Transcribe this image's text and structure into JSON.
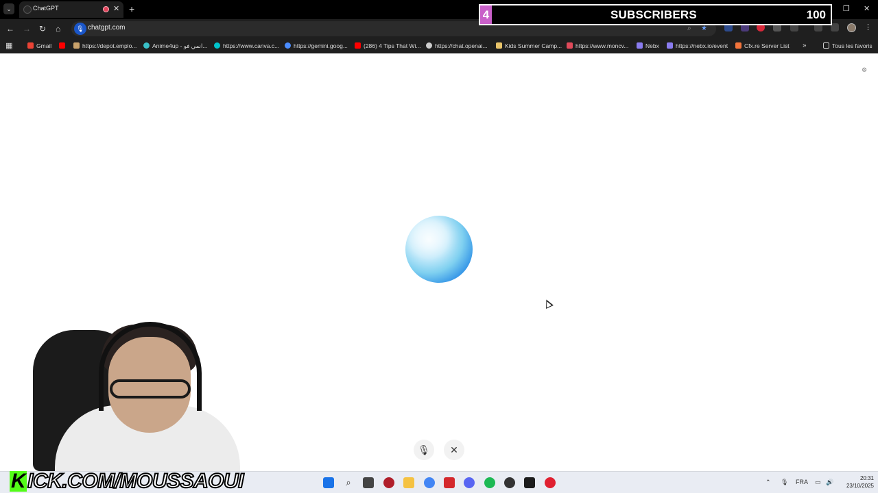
{
  "browser": {
    "tab": {
      "title": "ChatGPT"
    },
    "address": {
      "url": "chatgpt.com"
    },
    "bookmarks": [
      {
        "label": "Gmail",
        "icon": "gmail-icon",
        "color": "#ea4335"
      },
      {
        "label": "",
        "icon": "youtube-icon",
        "color": "#ff0000"
      },
      {
        "label": "https://depot.emplo...",
        "icon": "globe-icon",
        "color": "#c9a26b"
      },
      {
        "label": "Anime4up - انمي فو...",
        "icon": "anime-icon",
        "color": "#39c0c7"
      },
      {
        "label": "https://www.canva.c...",
        "icon": "canva-icon",
        "color": "#00c4cc"
      },
      {
        "label": "https://gemini.goog...",
        "icon": "gemini-icon",
        "color": "#4a8cff"
      },
      {
        "label": "(286) 4 Tips That Wi...",
        "icon": "youtube-icon",
        "color": "#ff0000"
      },
      {
        "label": "https://chat.openai...",
        "icon": "openai-icon",
        "color": "#cccccc"
      },
      {
        "label": "Kids Summer Camp...",
        "icon": "page-icon",
        "color": "#e8c46a"
      },
      {
        "label": "https://www.moncv...",
        "icon": "moncv-icon",
        "color": "#e04a5a"
      },
      {
        "label": "Nebx",
        "icon": "nebx-icon",
        "color": "#8a7cf0"
      },
      {
        "label": "https://nebx.io/event",
        "icon": "nebx-icon",
        "color": "#8a7cf0"
      },
      {
        "label": "Cfx.re Server List",
        "icon": "cfx-icon",
        "color": "#f2743b"
      }
    ],
    "all_bookmarks": "Tous les favoris"
  },
  "overlay": {
    "current": "4",
    "label": "SUBSCRIBERS",
    "goal": "100"
  },
  "stream": {
    "channel": "KICK.COM/MOUSSAOUI",
    "brand_color": "#53fc18"
  },
  "voice": {
    "mic_icon": "microphone-icon",
    "close_icon": "close-icon"
  },
  "taskbar": {
    "language": "FRA",
    "time": "20:31",
    "date": "23/10/2025"
  }
}
